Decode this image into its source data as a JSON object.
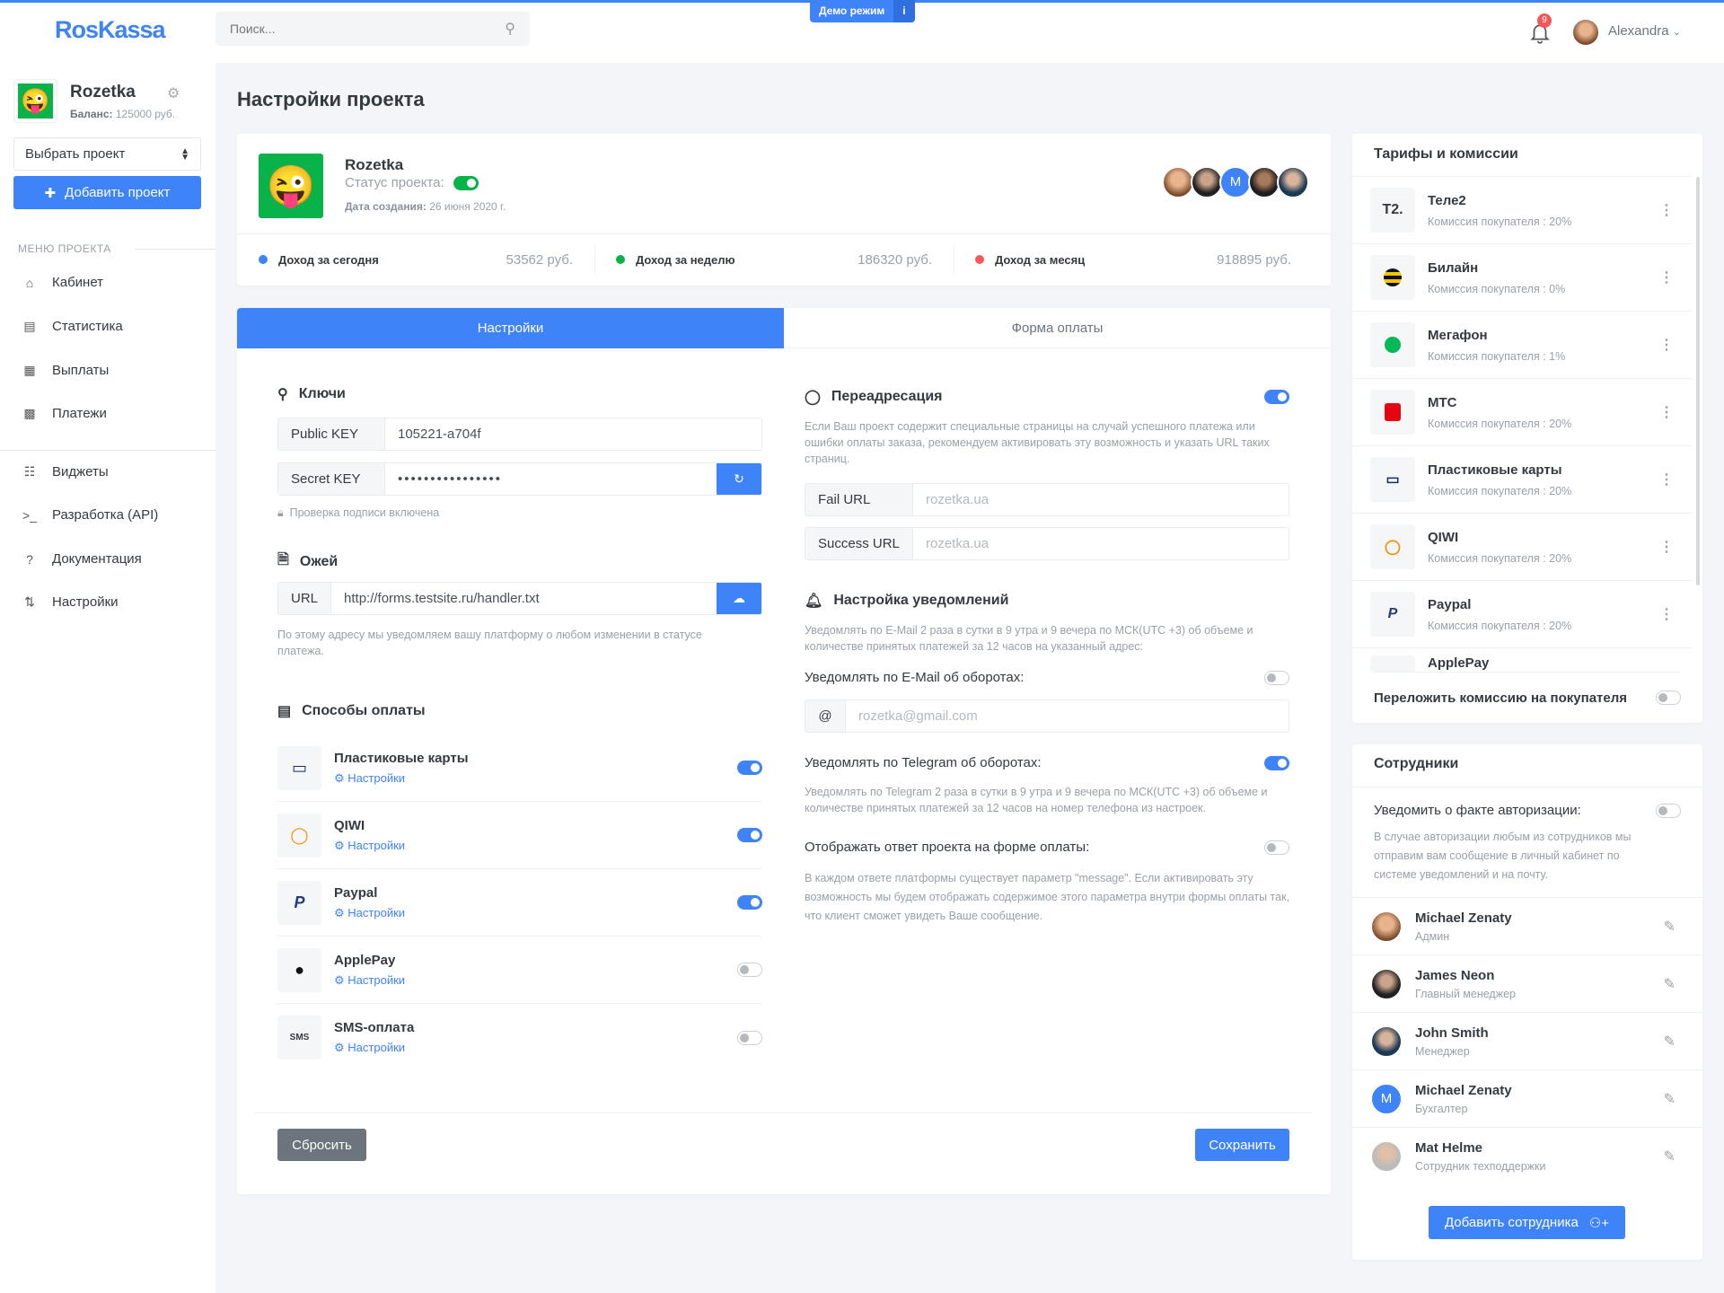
{
  "header": {
    "logo": "RosKassa",
    "search_placeholder": "Поиск...",
    "demo_label": "Демо режим",
    "demo_info": "i",
    "notifications_count": "9",
    "user_name": "Alexandra"
  },
  "sidebar": {
    "project_name": "Rozetka",
    "balance_label": "Баланс:",
    "balance_value": "125000 руб.",
    "select_project": "Выбрать проект",
    "add_project": "Добавить проект",
    "menu_heading": "МЕНЮ ПРОЕКТА",
    "items": [
      {
        "label": "Кабинет",
        "icon": "home-icon"
      },
      {
        "label": "Статистика",
        "icon": "chart-icon"
      },
      {
        "label": "Выплаты",
        "icon": "payout-icon"
      },
      {
        "label": "Платежи",
        "icon": "payments-icon"
      },
      {
        "label": "Виджеты",
        "icon": "sitemap-icon"
      },
      {
        "label": "Разработка (API)",
        "icon": "terminal-icon"
      },
      {
        "label": "Документация",
        "icon": "docs-icon"
      },
      {
        "label": "Настройки",
        "icon": "sliders-icon"
      }
    ]
  },
  "page": {
    "title": "Настройки проекта"
  },
  "project": {
    "name": "Rozetka",
    "status_label": "Статус проекта:",
    "status_on": true,
    "date_label": "Дата создания:",
    "date_value": "26 июня 2020 г.",
    "team_avatar_initial": "M",
    "stats": [
      {
        "label": "Доход за сегодня",
        "value": "53562 руб.",
        "color": "#3f83f8"
      },
      {
        "label": "Доход за неделю",
        "value": "186320 руб.",
        "color": "#0ab34a"
      },
      {
        "label": "Доход за месяц",
        "value": "918895 руб.",
        "color": "#f25858"
      }
    ]
  },
  "tabs": [
    {
      "label": "Настройки",
      "active": true
    },
    {
      "label": "Форма оплаты",
      "active": false
    }
  ],
  "keys": {
    "title": "Ключи",
    "public_label": "Public KEY",
    "public_value": "105221-a704f",
    "secret_label": "Secret KEY",
    "secret_value": "••••••••••••••••",
    "signature_note": "Проверка подписи включена"
  },
  "webhook": {
    "title": "Ожей",
    "url_label": "URL",
    "url_value": "http://forms.testsite.ru/handler.txt",
    "note": "По этому адресу мы уведомляем вашу платформу о любом изменении в статусе платежа."
  },
  "payment_methods": {
    "title": "Способы оплаты",
    "settings_label": "Настройки",
    "items": [
      {
        "name": "Пластиковые карты",
        "enabled": true
      },
      {
        "name": "QIWI",
        "enabled": true
      },
      {
        "name": "Paypal",
        "enabled": true
      },
      {
        "name": "ApplePay",
        "enabled": false
      },
      {
        "name": "SMS-оплата",
        "enabled": false
      }
    ]
  },
  "redirect": {
    "title": "Переадресация",
    "enabled": true,
    "desc": "Если Ваш проект содержит специальные страницы на случай успешного платежа или ошибки оплаты заказа, рекомендуем активировать эту возможность и указать URL таких страниц.",
    "fail_label": "Fail URL",
    "fail_placeholder": "rozetka.ua",
    "success_label": "Success URL",
    "success_placeholder": "rozetka.ua"
  },
  "notifications": {
    "title": "Настройка уведомлений",
    "desc": "Уведомлять по E-Mail 2 раза в сутки в 9 утра и 9 вечера по МСК(UTC +3) об объеме и количестве принятых платежей за 12 часов на указанный адрес:",
    "email_label": "Уведомлять по E-Mail об оборотах:",
    "email_enabled": false,
    "email_prefix": "@",
    "email_placeholder": "rozetka@gmail.com",
    "telegram_label": "Уведомлять по Telegram об оборотах:",
    "telegram_enabled": true,
    "telegram_desc": "Уведомлять по Telegram 2 раза в сутки в 9 утра и 9 вечера по МСК(UTC +3) об объеме и количестве принятых платежей за 12 часов на номер телефона из настроек.",
    "response_label": "Отображать ответ проекта на форме оплаты:",
    "response_enabled": false,
    "response_desc": "В каждом ответе платформы существует параметр \"message\". Если активировать эту возможность мы будем отображать содержимое этого параметра внутри формы оплаты так, что клиент сможет увидеть Ваше сообщение."
  },
  "actions": {
    "reset": "Сбросить",
    "save": "Сохранить"
  },
  "tariffs": {
    "title": "Тарифы и комиссии",
    "items": [
      {
        "name": "Теле2",
        "commission": "Комиссия покупателя : 20%",
        "logo": "T2."
      },
      {
        "name": "Билайн",
        "commission": "Комиссия покупателя : 0%"
      },
      {
        "name": "Мегафон",
        "commission": "Комиссия покупателя : 1%"
      },
      {
        "name": "МТС",
        "commission": "Комиссия покупателя : 20%"
      },
      {
        "name": "Пластиковые карты",
        "commission": "Комиссия покупателя : 20%"
      },
      {
        "name": "QIWI",
        "commission": "Комиссия покупателя : 20%"
      },
      {
        "name": "Paypal",
        "commission": "Комиссия покупателя : 20%"
      },
      {
        "name": "ApplePay",
        "commission": ""
      }
    ],
    "shift_label": "Переложить комиссию на покупателя",
    "shift_enabled": false
  },
  "employees": {
    "title": "Сотрудники",
    "notify_label": "Уведомить о факте авторизации:",
    "notify_enabled": false,
    "notify_desc": "В случае авторизации любым из сотрудников мы отправим вам сообщение в личный кабинет по системе уведомлений и на почту.",
    "items": [
      {
        "name": "Michael Zenaty",
        "role": "Админ"
      },
      {
        "name": "James Neon",
        "role": "Главный менеджер"
      },
      {
        "name": "John Smith",
        "role": "Менеджер"
      },
      {
        "name": "Michael Zenaty",
        "role": "Бухгалтер",
        "initial": "M"
      },
      {
        "name": "Mat Helme",
        "role": "Сотрудник техподдержки"
      }
    ],
    "add_label": "Добавить сотрудника"
  }
}
